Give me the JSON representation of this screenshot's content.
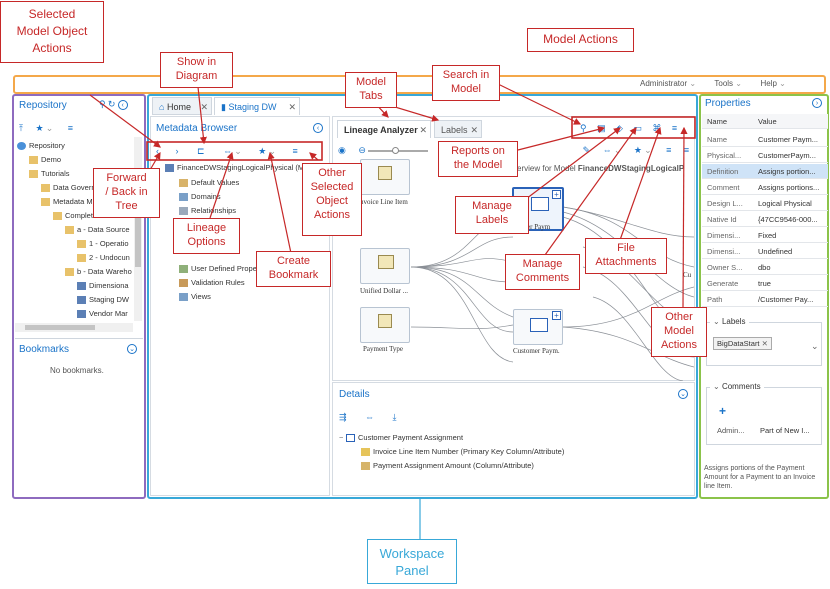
{
  "topbar": {
    "user": "Administrator",
    "tools": "Tools",
    "help": "Help"
  },
  "repository": {
    "title": "Repository",
    "tree": [
      {
        "label": "Repository"
      },
      {
        "label": "Demo"
      },
      {
        "label": "Tutorials"
      },
      {
        "label": "Data Govern"
      },
      {
        "label": "Metadata M"
      },
      {
        "label": "Complet"
      },
      {
        "label": "a - Data Source"
      },
      {
        "label": "1 - Operatio"
      },
      {
        "label": "2 - Undocun"
      },
      {
        "label": "b - Data Wareho"
      },
      {
        "label": "Dimensiona"
      },
      {
        "label": "Staging DW"
      },
      {
        "label": "Vendor Mar"
      }
    ],
    "bookmarks_title": "Bookmarks",
    "no_bookmarks": "No bookmarks."
  },
  "workspace": {
    "tabs": [
      {
        "label": "Home"
      },
      {
        "label": "Staging DW"
      }
    ],
    "metadata_browser": {
      "title": "Metadata Browser",
      "tree": [
        {
          "label": "FinanceDWStagingLogicalPhysical (Model)"
        },
        {
          "label": "Default Values"
        },
        {
          "label": "Domains"
        },
        {
          "label": "Relationships"
        },
        {
          "label": "User Defined Prope"
        },
        {
          "label": "Validation Rules"
        },
        {
          "label": "Views"
        }
      ]
    },
    "model_tabs": [
      {
        "label": "Lineage Analyzer"
      },
      {
        "label": "Labels"
      }
    ],
    "diagram": {
      "overview_text": "verview for Model ",
      "overview_model": "FinanceDWStagingLogicalP",
      "nodes": [
        {
          "label": "nvoice Line Item"
        },
        {
          "label": "er Paym"
        },
        {
          "label": "Unified Dollar ..."
        },
        {
          "label": "Payment Type"
        },
        {
          "label": "Customer Paym."
        },
        {
          "label": "Cu"
        }
      ]
    },
    "details": {
      "title": "Details",
      "tree": [
        {
          "label": "Customer Payment Assignment"
        },
        {
          "label": "Invoice Line Item Number (Primary Key Column/Attribute)"
        },
        {
          "label": "Payment Assignment Amount (Column/Attribute)"
        }
      ]
    }
  },
  "properties": {
    "title": "Properties",
    "header": {
      "name": "Name",
      "value": "Value"
    },
    "rows": [
      {
        "name": "Name",
        "value": "Customer Paym..."
      },
      {
        "name": "Physical...",
        "value": "CustomerPaym..."
      },
      {
        "name": "Definition",
        "value": "Assigns portion..."
      },
      {
        "name": "Comment",
        "value": "Assigns portions..."
      },
      {
        "name": "Design L...",
        "value": "Logical Physical"
      },
      {
        "name": "Native Id",
        "value": "{47CC9546-000..."
      },
      {
        "name": "Dimensi...",
        "value": "Fixed"
      },
      {
        "name": "Dimensi...",
        "value": "Undefined"
      },
      {
        "name": "Owner S...",
        "value": "dbo"
      },
      {
        "name": "Generate",
        "value": "true"
      },
      {
        "name": "Path",
        "value": "/Customer Pay..."
      }
    ],
    "labels_title": "Labels",
    "label_tag": "BigDataStart",
    "comments_title": "Comments",
    "comment_author": "Admin...",
    "comment_text": "Part of New I...",
    "definition_text": "Assigns portions of the Payment Amount for a Payment to an Invoice line Item."
  },
  "callouts": {
    "selected_model_object_actions": "Selected\nModel Object\nActions",
    "show_in_diagram": "Show in\nDiagram",
    "model_tabs": "Model\nTabs",
    "search_in_model": "Search in\nModel",
    "model_actions": "Model Actions",
    "reports_on_the_model": "Reports on\nthe Model",
    "forward_back_in_tree": "Forward\n/ Back in\nTree",
    "other_selected_object_actions": "Other\nSelected\nObject\nActions",
    "manage_labels": "Manage\nLabels",
    "lineage_options": "Lineage\nOptions",
    "create_bookmark": "Create\nBookmark",
    "manage_comments": "Manage\nComments",
    "file_attachments": "File\nAttachments",
    "other_model_actions": "Other\nModel\nActions",
    "workspace_panel": "Workspace\nPanel"
  },
  "colors": {
    "accent": "#1a73c8",
    "callout": "#c62828",
    "repository_frame": "#8e6bbf",
    "workspace_frame": "#38a8d8",
    "properties_frame": "#8bc34a",
    "topbar_frame": "#f4a84a",
    "selected_row": "#cfe3f7"
  }
}
